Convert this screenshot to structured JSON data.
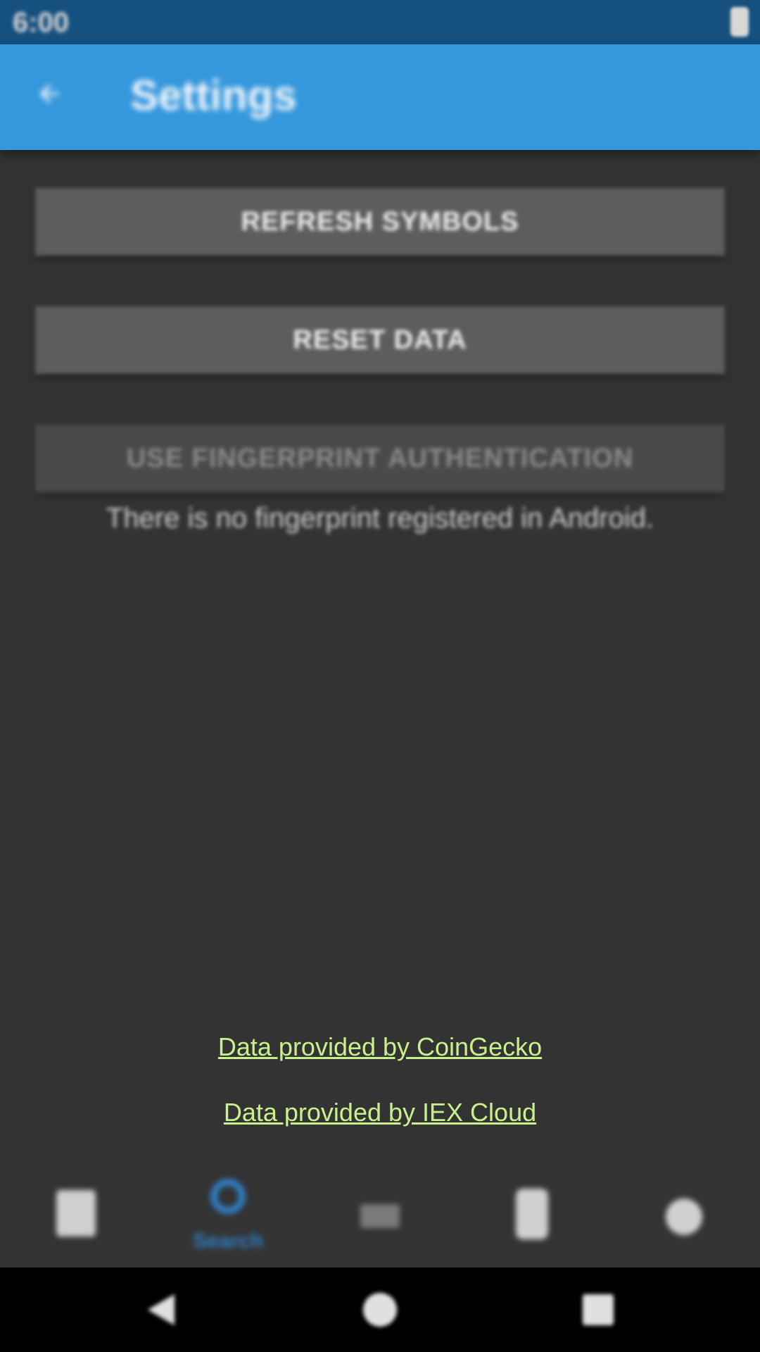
{
  "status_bar": {
    "time": "6:00"
  },
  "app_bar": {
    "title": "Settings",
    "back_icon": "arrow-back-icon"
  },
  "settings": {
    "refresh_symbols_label": "REFRESH SYMBOLS",
    "reset_data_label": "RESET DATA",
    "fingerprint_label": "USE FINGERPRINT AUTHENTICATION",
    "fingerprint_note": "There is no fingerprint registered in Android."
  },
  "links": {
    "coingecko": "Data provided by CoinGecko",
    "iex": "Data provided by IEX Cloud"
  },
  "bottom_nav": {
    "items": [
      {
        "icon": "home-icon",
        "label": ""
      },
      {
        "icon": "search-icon",
        "label": "Search",
        "active": true
      },
      {
        "icon": "news-icon",
        "label": ""
      },
      {
        "icon": "portfolio-icon",
        "label": ""
      },
      {
        "icon": "settings-icon",
        "label": ""
      }
    ]
  },
  "colors": {
    "status_bar": "#15507e",
    "app_bar": "#3598dc",
    "background": "#333333",
    "button": "#5d5d5d",
    "link": "#c8f08c",
    "nav_active": "#2f7ec2"
  }
}
